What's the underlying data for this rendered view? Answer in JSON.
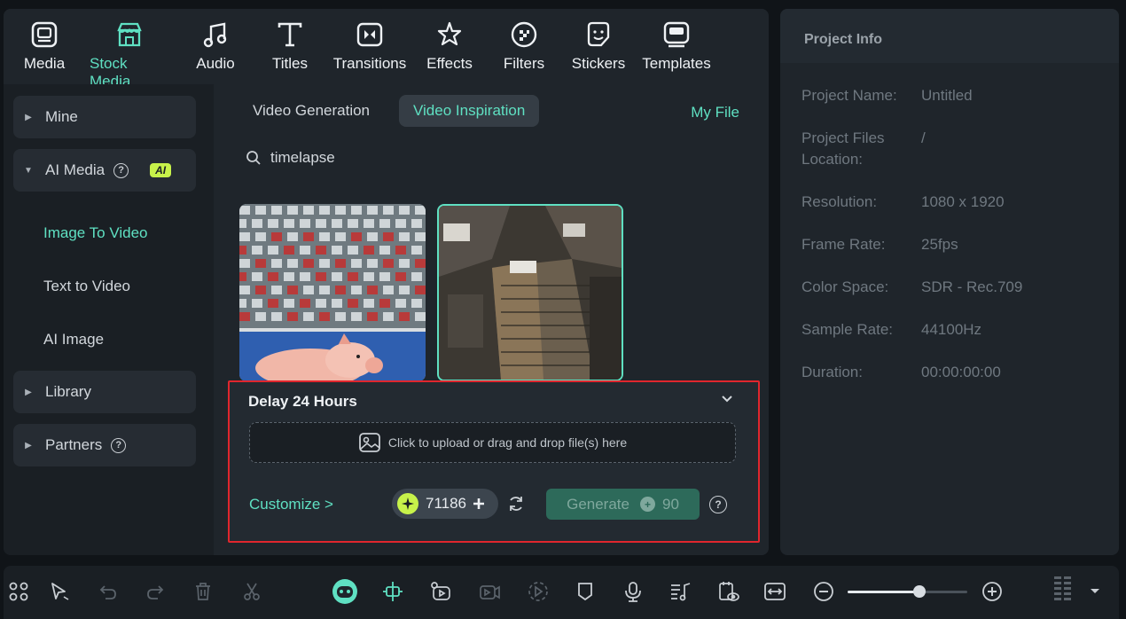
{
  "toolbar": {
    "items": [
      {
        "label": "Media",
        "icon": "media-icon"
      },
      {
        "label": "Stock Media",
        "icon": "stock-media-icon",
        "active": true
      },
      {
        "label": "Audio",
        "icon": "audio-icon"
      },
      {
        "label": "Titles",
        "icon": "titles-icon"
      },
      {
        "label": "Transitions",
        "icon": "transitions-icon"
      },
      {
        "label": "Effects",
        "icon": "effects-icon"
      },
      {
        "label": "Filters",
        "icon": "filters-icon"
      },
      {
        "label": "Stickers",
        "icon": "stickers-icon"
      },
      {
        "label": "Templates",
        "icon": "templates-icon"
      }
    ]
  },
  "sidebar": {
    "mine": "Mine",
    "ai_media": "AI Media",
    "ai_badge": "AI",
    "image_to_video": "Image To Video",
    "text_to_video": "Text to Video",
    "ai_image": "AI Image",
    "library": "Library",
    "partners": "Partners"
  },
  "content": {
    "tabs": [
      "Video Generation",
      "Video Inspiration"
    ],
    "active_tab": "Video Inspiration",
    "my_file": "My File",
    "search_value": "timelapse"
  },
  "generate": {
    "title": "Delay 24 Hours",
    "upload_text": "Click to upload or drag and drop file(s) here",
    "customize": "Customize >",
    "credits": "71186",
    "generate_label": "Generate",
    "generate_cost": "90"
  },
  "project_info": {
    "title": "Project Info",
    "rows": [
      {
        "label": "Project Name:",
        "value": "Untitled"
      },
      {
        "label": "Project Files Location:",
        "value": "/"
      },
      {
        "label": "Resolution:",
        "value": "1080 x 1920"
      },
      {
        "label": "Frame Rate:",
        "value": "25fps"
      },
      {
        "label": "Color Space:",
        "value": "SDR - Rec.709"
      },
      {
        "label": "Sample Rate:",
        "value": "44100Hz"
      },
      {
        "label": "Duration:",
        "value": "00:00:00:00"
      }
    ]
  },
  "colors": {
    "accent": "#5fe0c2",
    "highlight_border": "#e0262d",
    "ai_badge": "#c7f24a"
  },
  "zoom_slider_level": 0.6
}
